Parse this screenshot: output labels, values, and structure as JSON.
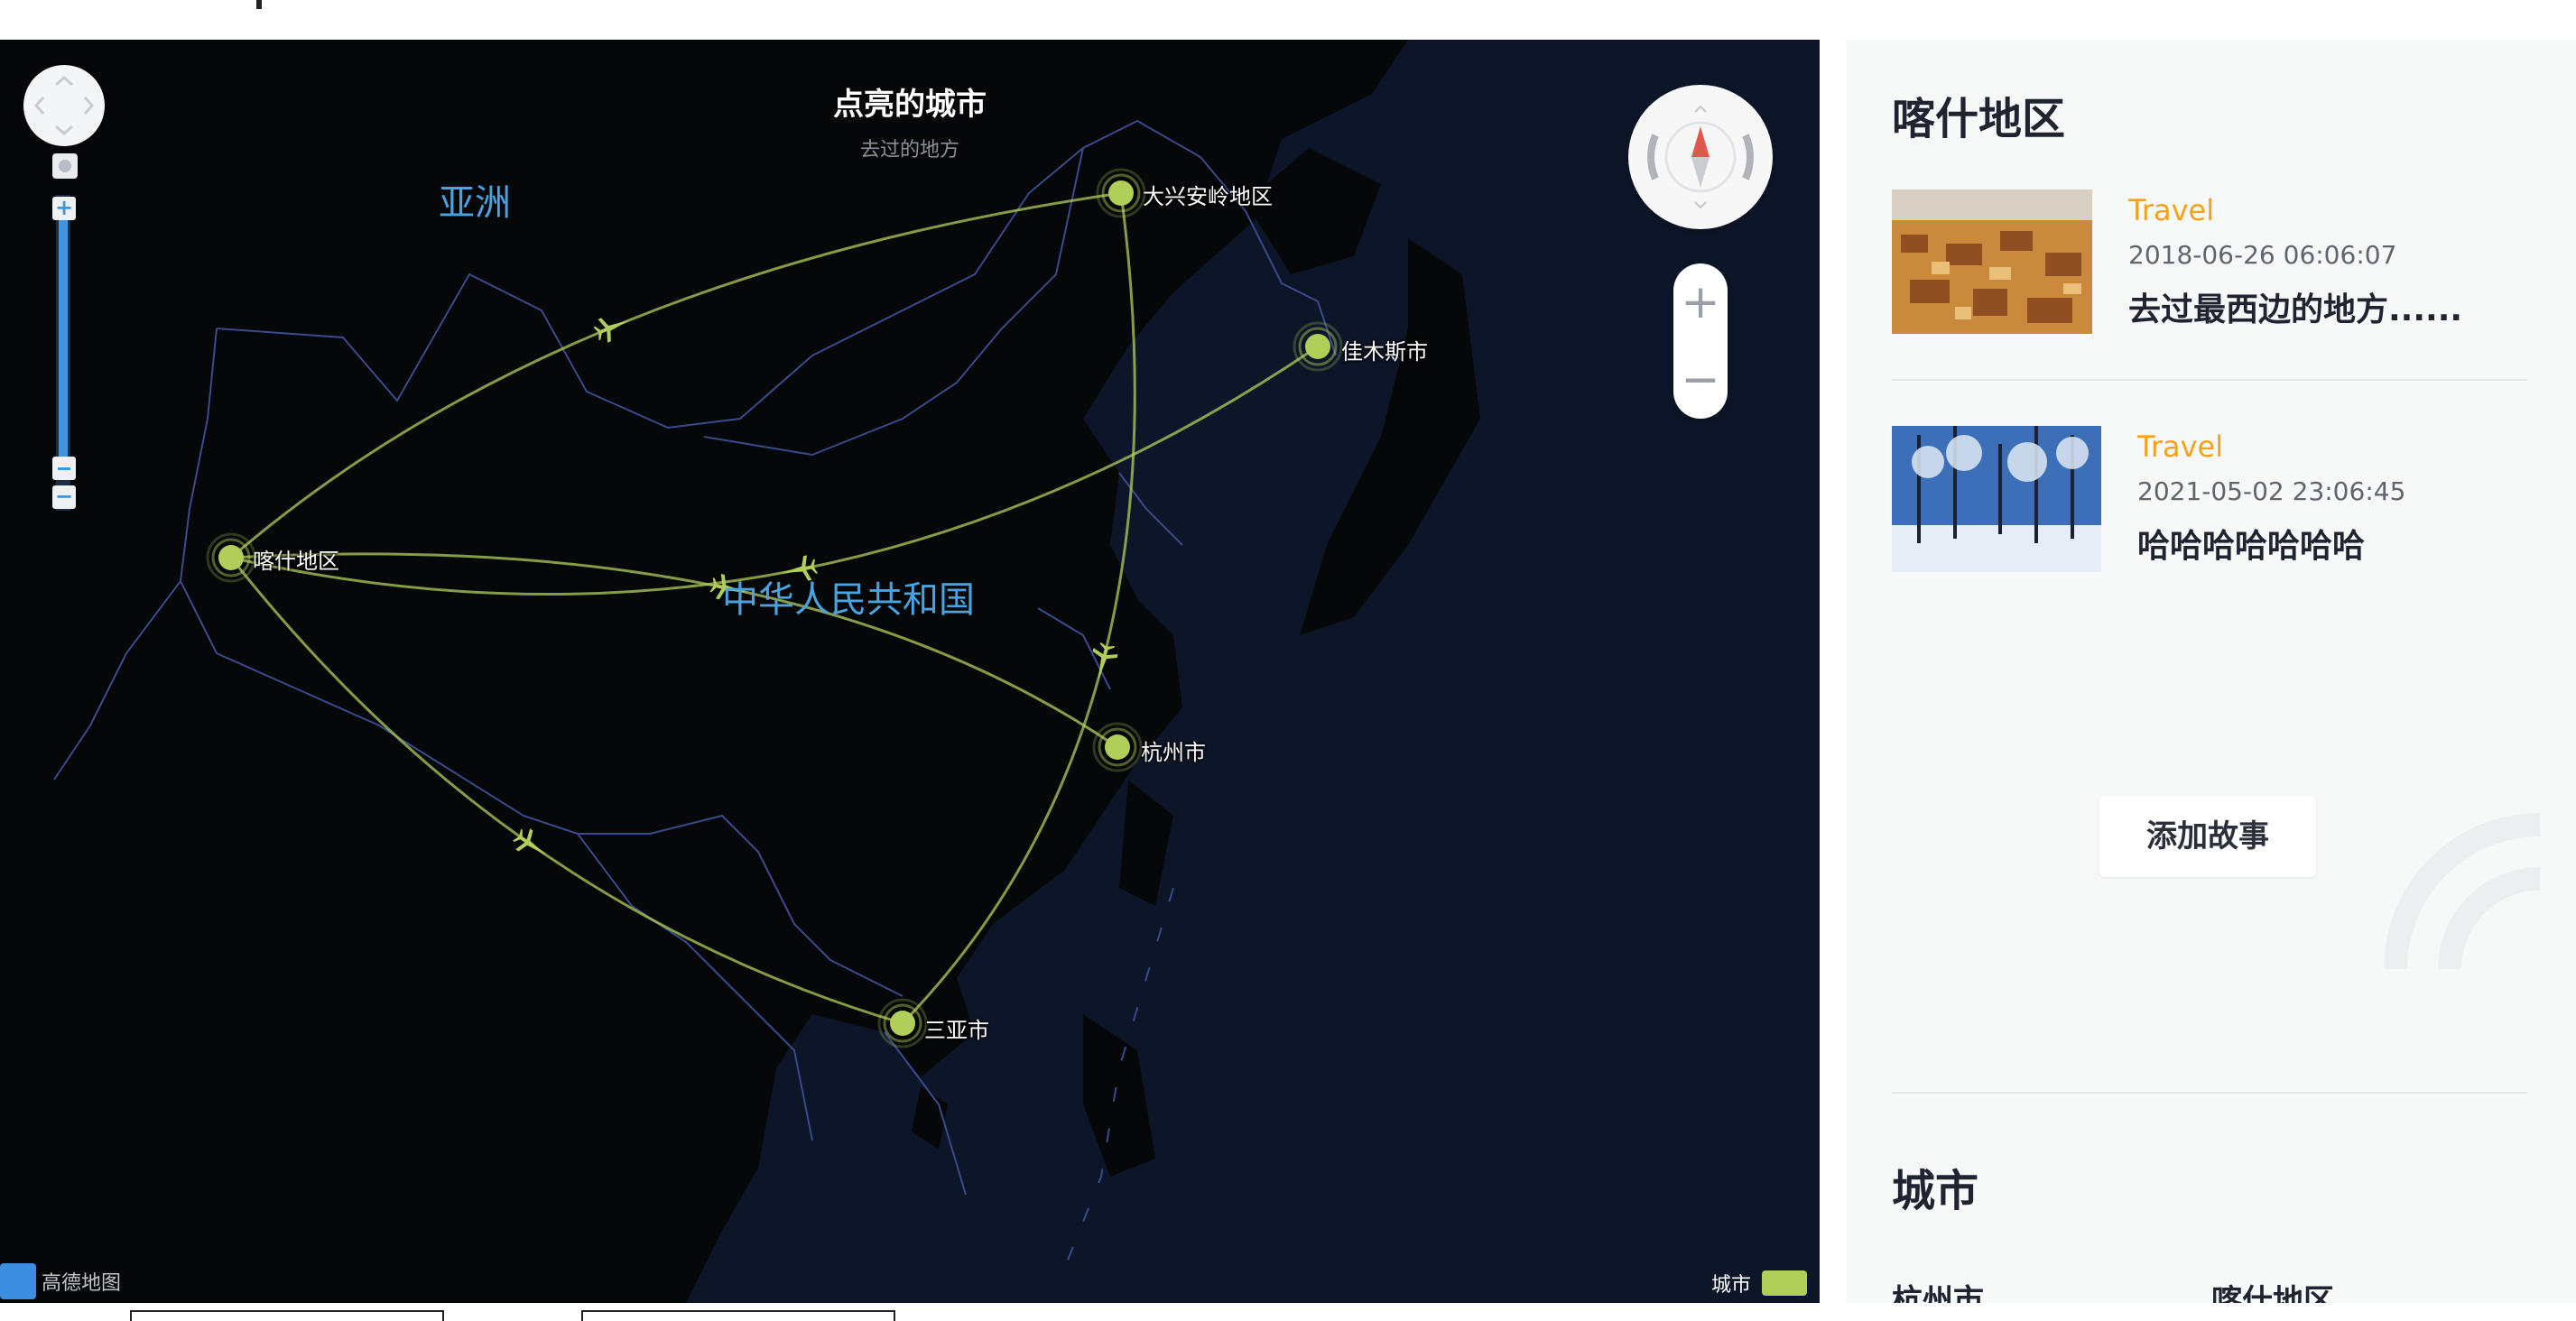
{
  "map": {
    "title": "点亮的城市",
    "subtitle": "去过的地方",
    "regions": [
      {
        "name": "亚洲"
      },
      {
        "name": "中华人民共和国"
      }
    ],
    "cities": [
      "大兴安岭地区",
      "佳木斯市",
      "喀什地区",
      "杭州市",
      "三亚市"
    ],
    "route_color": "#b1ce5a",
    "logo_text": "高德地图",
    "legend": {
      "label": "城市",
      "color": "#b1ce5a"
    },
    "zoom_in_label": "+",
    "zoom_out_label": "−"
  },
  "sidebar": {
    "region_title": "喀什地区",
    "stories": [
      {
        "tag": "Travel",
        "date": "2018-06-26 06:06:07",
        "text": "去过最西边的地方......"
      },
      {
        "tag": "Travel",
        "date": "2021-05-02 23:06:45",
        "text": "哈哈哈哈哈哈哈"
      }
    ],
    "add_story": "添加故事",
    "cities_title": "城市",
    "cities": [
      "杭州市",
      "喀什地区"
    ]
  },
  "colors": {
    "accent": "#f4a21c",
    "map_bg": "#0b1324",
    "border_line": "#3a4a8a",
    "zoom_blue": "#3f96dc"
  }
}
